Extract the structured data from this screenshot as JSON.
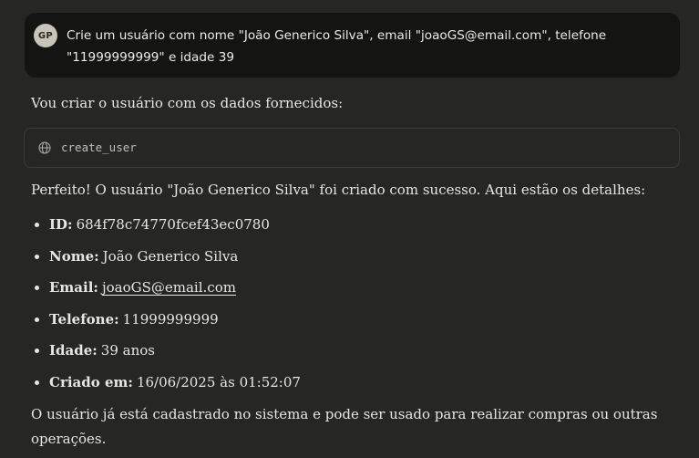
{
  "user_message": {
    "avatar_initials": "GP",
    "line1": "Crie um usuário com nome \"João Generico Silva\", email \"joaoGS@email.com\", telefone",
    "line2": "\"11999999999\" e idade 39"
  },
  "assistant": {
    "intro": "Vou criar o usuário com os dados fornecidos:",
    "tool_call": {
      "icon": "globe-icon",
      "name": "create_user"
    },
    "result_text": "Perfeito! O usuário \"João Generico Silva\" foi criado com sucesso. Aqui estão os detalhes:",
    "details": [
      {
        "label": "ID:",
        "value": "684f78c74770fcef43ec0780"
      },
      {
        "label": "Nome:",
        "value": "João Generico Silva"
      },
      {
        "label": "Email:",
        "value": "joaoGS@email.com"
      },
      {
        "label": "Telefone:",
        "value": "11999999999"
      },
      {
        "label": "Idade:",
        "value": "39 anos"
      },
      {
        "label": "Criado em:",
        "value": "16/06/2025 às 01:52:07"
      }
    ],
    "closing_line1": "O usuário já está cadastrado no sistema e pode ser usado para realizar compras ou outras",
    "closing_line2": "operações."
  },
  "colors": {
    "background": "#262624",
    "user_bubble": "#141413",
    "avatar": "#c9c4b8",
    "text": "#e8e6df",
    "tool_border": "#3d3c39"
  }
}
